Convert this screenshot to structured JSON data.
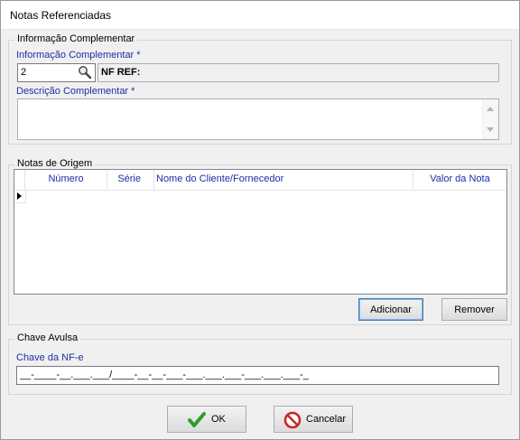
{
  "window": {
    "title": "Notas Referenciadas"
  },
  "info_group": {
    "legend": "Informação Complementar",
    "info_label": "Informação Complementar *",
    "info_value": "2",
    "nf_ref_label": "NF REF:",
    "desc_label": "Descrição Complementar *",
    "desc_value": ""
  },
  "origem_group": {
    "legend": "Notas de Origem",
    "columns": [
      "Número",
      "Série",
      "Nome do Cliente/Fornecedor",
      "Valor da Nota"
    ],
    "add_button": "Adicionar",
    "remove_button": "Remover"
  },
  "chave_group": {
    "legend": "Chave Avulsa",
    "chave_label": "Chave da NF-e",
    "chave_value": "__-____-__.___.___/____-__-__-___-___.___.___-___.___.___-_"
  },
  "footer": {
    "ok_button": "OK",
    "cancel_button": "Cancelar"
  },
  "icons": {
    "search": "search-icon",
    "ok": "check-icon",
    "cancel": "cancel-icon",
    "row_pointer": "row-pointer-icon"
  },
  "colors": {
    "label_blue": "#1b2fa5",
    "ok_green": "#2e9e2a",
    "cancel_red": "#c82828"
  }
}
